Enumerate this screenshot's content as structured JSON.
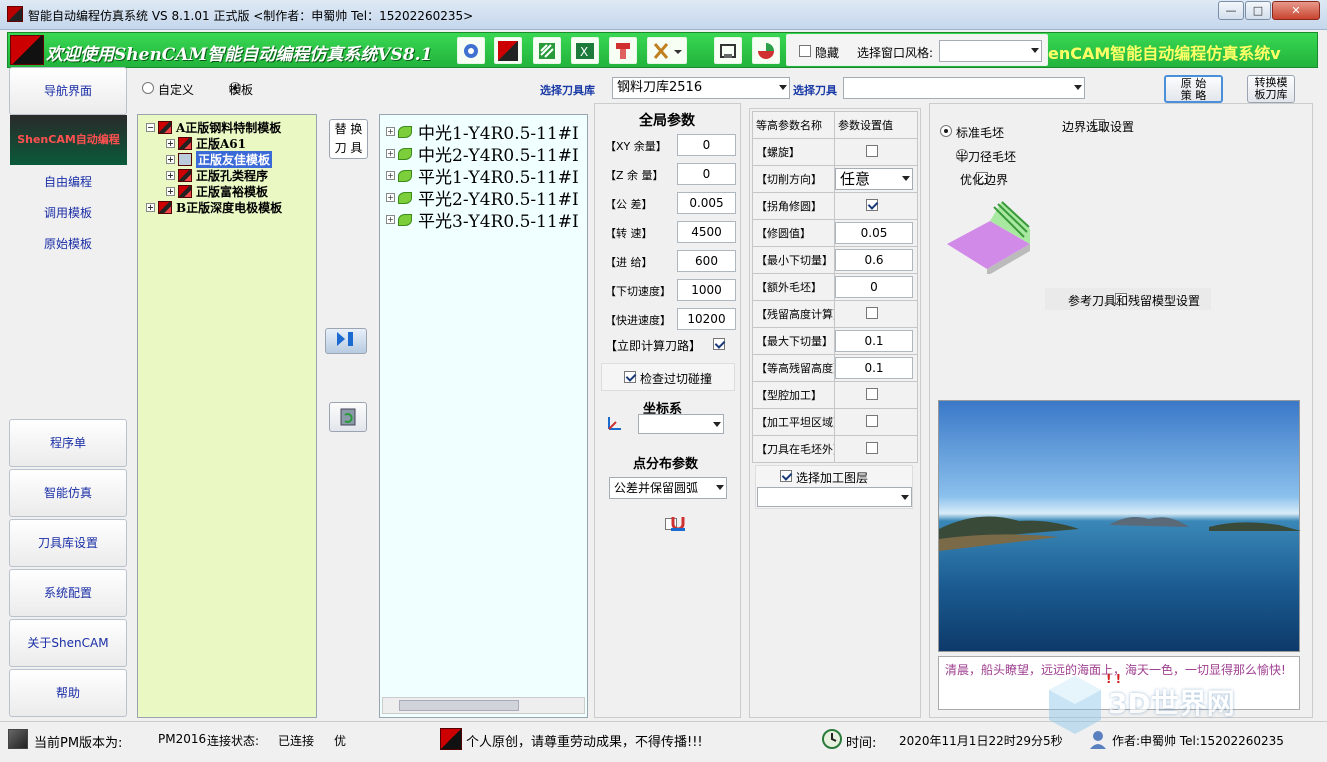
{
  "window": {
    "title": "智能自动编程仿真系统 VS 8.1.01 正式版 <制作者：申蜀帅   Tel：15202260235>",
    "min": "—",
    "max": "□",
    "close": "✕"
  },
  "banner": {
    "welcome": "欢迎使用ShenCAM智能自动编程仿真系统VS8.1",
    "scroll_text": "enCAM智能自动编程仿真系统v",
    "hide_label": "隐藏",
    "style_label": "选择窗口风格:",
    "style_value": ""
  },
  "nav": {
    "home": "导航界面",
    "logo_text": "ShenCAM自动编程",
    "free": "自由编程",
    "use_tpl": "调用模板",
    "orig_tpl": "原始模板",
    "program": "程序单",
    "sim": "智能仿真",
    "toollib": "刀具库设置",
    "config": "系统配置",
    "about": "关于ShenCAM",
    "help": "帮助"
  },
  "mode": {
    "custom": "自定义",
    "template": "模板"
  },
  "toolsel": {
    "lib_label": "选择刀具库",
    "lib_value": "钢料刀库2516",
    "tool_label": "选择刀具",
    "tool_value": ""
  },
  "topbtns": {
    "orig": "原 始\n策 略",
    "switch": "转换模\n板刀库"
  },
  "tree": [
    {
      "label": "A正版钢料特制模板",
      "pm": "−"
    },
    {
      "label": "正版A61",
      "pm": "+"
    },
    {
      "label": "正版友佳模板",
      "pm": "+"
    },
    {
      "label": "正版孔类程序",
      "pm": "+"
    },
    {
      "label": "正版富裕模板",
      "pm": "+"
    },
    {
      "label": "B正版深度电极模板",
      "pm": "+"
    }
  ],
  "replace_btn": "替 换\n刀 具",
  "ops": [
    "中光1-Y4R0.5-11#I",
    "中光2-Y4R0.5-11#I",
    "平光1-Y4R0.5-11#I",
    "平光2-Y4R0.5-11#I",
    "平光3-Y4R0.5-11#I"
  ],
  "global": {
    "title": "全局参数",
    "params": [
      {
        "label": "【XY 余量】",
        "value": "0"
      },
      {
        "label": "【Z 余 量】",
        "value": "0"
      },
      {
        "label": "【公    差】",
        "value": "0.005"
      },
      {
        "label": "【转    速】",
        "value": "4500"
      },
      {
        "label": "【进    给】",
        "value": "600"
      },
      {
        "label": "【下切速度】",
        "value": "1000"
      },
      {
        "label": "【快进速度】",
        "value": "10200"
      }
    ],
    "calc_now": "【立即计算刀路】",
    "check_collision": "检查过切碰撞",
    "coord_title": "坐标系",
    "coord_value": "",
    "points_title": "点分布参数",
    "points_value": "公差并保留圆弧"
  },
  "zlevel": {
    "col1": "等高参数名称",
    "col2": "参数设置值",
    "rows": [
      {
        "name": "【螺旋】",
        "type": "cb",
        "on": false
      },
      {
        "name": "【切削方向】",
        "type": "combo",
        "value": "任意"
      },
      {
        "name": "【拐角修圆】",
        "type": "cb",
        "on": true
      },
      {
        "name": "【修圆值】",
        "type": "inp",
        "value": "0.05"
      },
      {
        "name": "【最小下切量】",
        "type": "inp",
        "value": "0.6"
      },
      {
        "name": "【额外毛坯】",
        "type": "inp",
        "value": "0"
      },
      {
        "name": "【残留高度计算】",
        "type": "cb",
        "on": false
      },
      {
        "name": "【最大下切量】",
        "type": "inp",
        "value": "0.1"
      },
      {
        "name": "【等高残留高度】",
        "type": "inp",
        "value": "0.1"
      },
      {
        "name": "【型腔加工】",
        "type": "cb",
        "on": false
      },
      {
        "name": "【加工平坦区域】",
        "type": "cb",
        "on": false
      },
      {
        "name": "【刀具在毛坯外】",
        "type": "cb",
        "on": false
      }
    ],
    "layer_label": "选择加工图层",
    "layer_value": ""
  },
  "stock": {
    "std": "标准毛坯",
    "half": "半刀径毛坯",
    "optimize": "优化边界",
    "boundary": "边界选取设置",
    "refmodel": "参考刀具和残留模型设置"
  },
  "photo_caption": "清晨，船头瞭望，远远的海面上，海天一色，一切显得那么愉快!",
  "status": {
    "pm_label": "当前PM版本为:",
    "pm_value": "PM2016",
    "conn_label": "连接状态:",
    "conn_value": "已连接",
    "quality": "优",
    "notice": "个人原创，请尊重劳动成果，不得传播!!!",
    "time_label": "时间:",
    "time_value": "2020年11月1日22时29分5秒",
    "author": "作者:申蜀帅 Tel:15202260235"
  },
  "watermark": "3D世界网"
}
